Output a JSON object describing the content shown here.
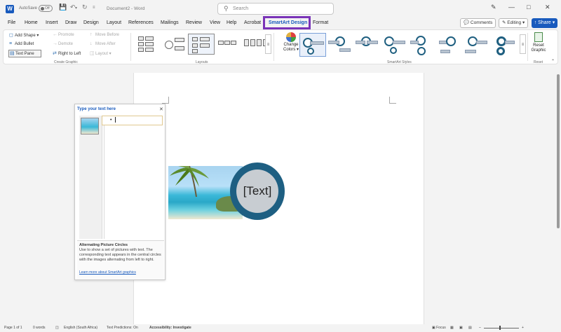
{
  "titlebar": {
    "autosave_label": "AutoSave",
    "autosave_state": "Off",
    "doc_title": "Document2 - Word",
    "search_placeholder": "Search"
  },
  "menu": {
    "items": [
      "File",
      "Home",
      "Insert",
      "Draw",
      "Design",
      "Layout",
      "References",
      "Mailings",
      "Review",
      "View",
      "Help",
      "Acrobat",
      "SmartArt Design",
      "Format"
    ],
    "active": "SmartArt Design",
    "comments_label": "Comments",
    "editing_label": "Editing",
    "share_label": "Share"
  },
  "ribbon": {
    "create_graphic": {
      "add_shape": "Add Shape",
      "add_bullet": "Add Bullet",
      "text_pane": "Text Pane",
      "promote": "Promote",
      "demote": "Demote",
      "right_to_left": "Right to Left",
      "move_before": "Move Before",
      "move_after": "Move After",
      "layout": "Layout",
      "group_label": "Create Graphic"
    },
    "layouts_label": "Layouts",
    "change_colors_line1": "Change",
    "change_colors_line2": "Colors",
    "smartart_styles_label": "SmartArt Styles",
    "reset_line1": "Reset",
    "reset_line2": "Graphic",
    "reset_group_label": "Reset"
  },
  "smartart": {
    "placeholder_text": "[Text]"
  },
  "text_pane": {
    "title": "Type your text here",
    "bullet": "•",
    "description_title": "Alternating Picture Circles",
    "description_body": "Use to show a set of pictures with text. The corresponding text appears in the central circles with the images alternating from left to right.",
    "learn_more": "Learn more about SmartArt graphics"
  },
  "statusbar": {
    "page": "Page 1 of 1",
    "words": "0 words",
    "language": "English (South Africa)",
    "text_predictions": "Text Predictions: On",
    "accessibility": "Accessibility: Investigate",
    "focus": "Focus"
  },
  "colors": {
    "accent": "#185abd",
    "highlight_box": "#7a33b8",
    "smartart_ring": "#1e5f82",
    "smartart_circle": "#c8cdd2"
  }
}
